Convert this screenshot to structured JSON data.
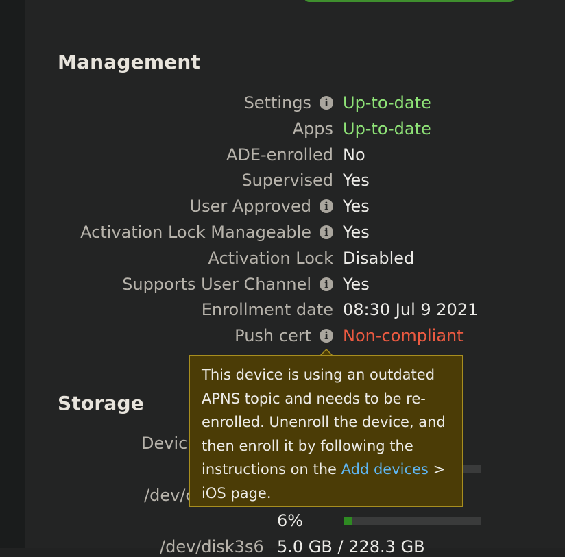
{
  "management": {
    "title": "Management",
    "rows": [
      {
        "label": "Settings",
        "info": true,
        "value": "Up-to-date",
        "status": "ok"
      },
      {
        "label": "Apps",
        "info": false,
        "value": "Up-to-date",
        "status": "ok"
      },
      {
        "label": "ADE-enrolled",
        "info": false,
        "value": "No",
        "status": "normal"
      },
      {
        "label": "Supervised",
        "info": false,
        "value": "Yes",
        "status": "normal"
      },
      {
        "label": "User Approved",
        "info": true,
        "value": "Yes",
        "status": "normal"
      },
      {
        "label": "Activation Lock Manageable",
        "info": true,
        "value": "Yes",
        "status": "normal"
      },
      {
        "label": "Activation Lock",
        "info": false,
        "value": "Disabled",
        "status": "normal"
      },
      {
        "label": "Supports User Channel",
        "info": true,
        "value": "Yes",
        "status": "normal"
      },
      {
        "label": "Enrollment date",
        "info": false,
        "value": "08:30 Jul 9 2021",
        "status": "normal"
      },
      {
        "label": "Push cert",
        "info": true,
        "value": "Non-compliant",
        "status": "bad"
      }
    ]
  },
  "storage": {
    "title": "Storage",
    "device_label_partial": "Devic",
    "disk_label_partial": "/dev/c",
    "percent_label": "6%",
    "percent_value": 0.06,
    "bottom_label_partial": "/dev/disk3s6",
    "bottom_value_partial": "5.0 GB / 228.3 GB"
  },
  "tooltip": {
    "text_before": "This device is using an outdated APNS topic and needs to be re-enrolled. Unenroll the device, and then enroll it by following the instructions on the ",
    "link": "Add devices",
    "text_after": " > iOS page."
  },
  "colors": {
    "ok": "#8ee277",
    "bad": "#ec5a41",
    "link": "#5fb6f2",
    "tooltip_bg": "#4b3c06",
    "accent_button": "#3f8f2e"
  },
  "icons": {
    "info": "info-circle-icon",
    "glyph": "i"
  }
}
